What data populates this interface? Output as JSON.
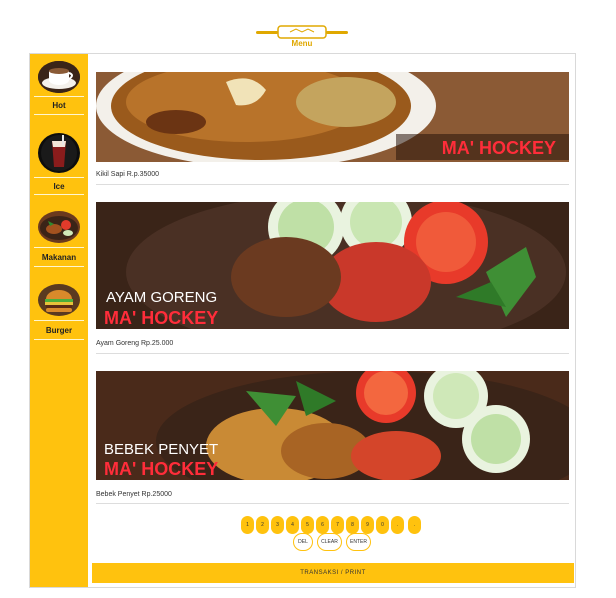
{
  "header": {
    "logo_title": "Menu",
    "logo_icon": "rolling-pin-icon",
    "accent_color": "#ffc20e"
  },
  "sidebar": {
    "items": [
      {
        "label": "Hot",
        "icon": "coffee-cup-icon"
      },
      {
        "label": "Ice",
        "icon": "iced-drink-icon"
      },
      {
        "label": "Makanan",
        "icon": "food-plate-icon"
      },
      {
        "label": "Burger",
        "icon": "burger-icon"
      }
    ]
  },
  "menu": {
    "items": [
      {
        "banner_brand": "MA' HOCKEY",
        "banner_title": "",
        "caption": "Kikil Sapi R.p.35000"
      },
      {
        "banner_brand": "MA' HOCKEY",
        "banner_title": "AYAM GORENG",
        "caption": "Ayam Goreng  Rp.25.000"
      },
      {
        "banner_brand": "MA' HOCKEY",
        "banner_title": "BEBEK PENYET",
        "caption": "Bebek Penyet  Rp.25000"
      }
    ]
  },
  "keypad": {
    "keys": [
      "1",
      "2",
      "3",
      "4",
      "5",
      "6",
      "7",
      "8",
      "9",
      "0",
      ".",
      "."
    ],
    "actions": [
      "DEL",
      "CLEAR",
      "ENTER"
    ]
  },
  "footer": {
    "transaksi_label": "TRANSAKSI  /  PRINT"
  }
}
